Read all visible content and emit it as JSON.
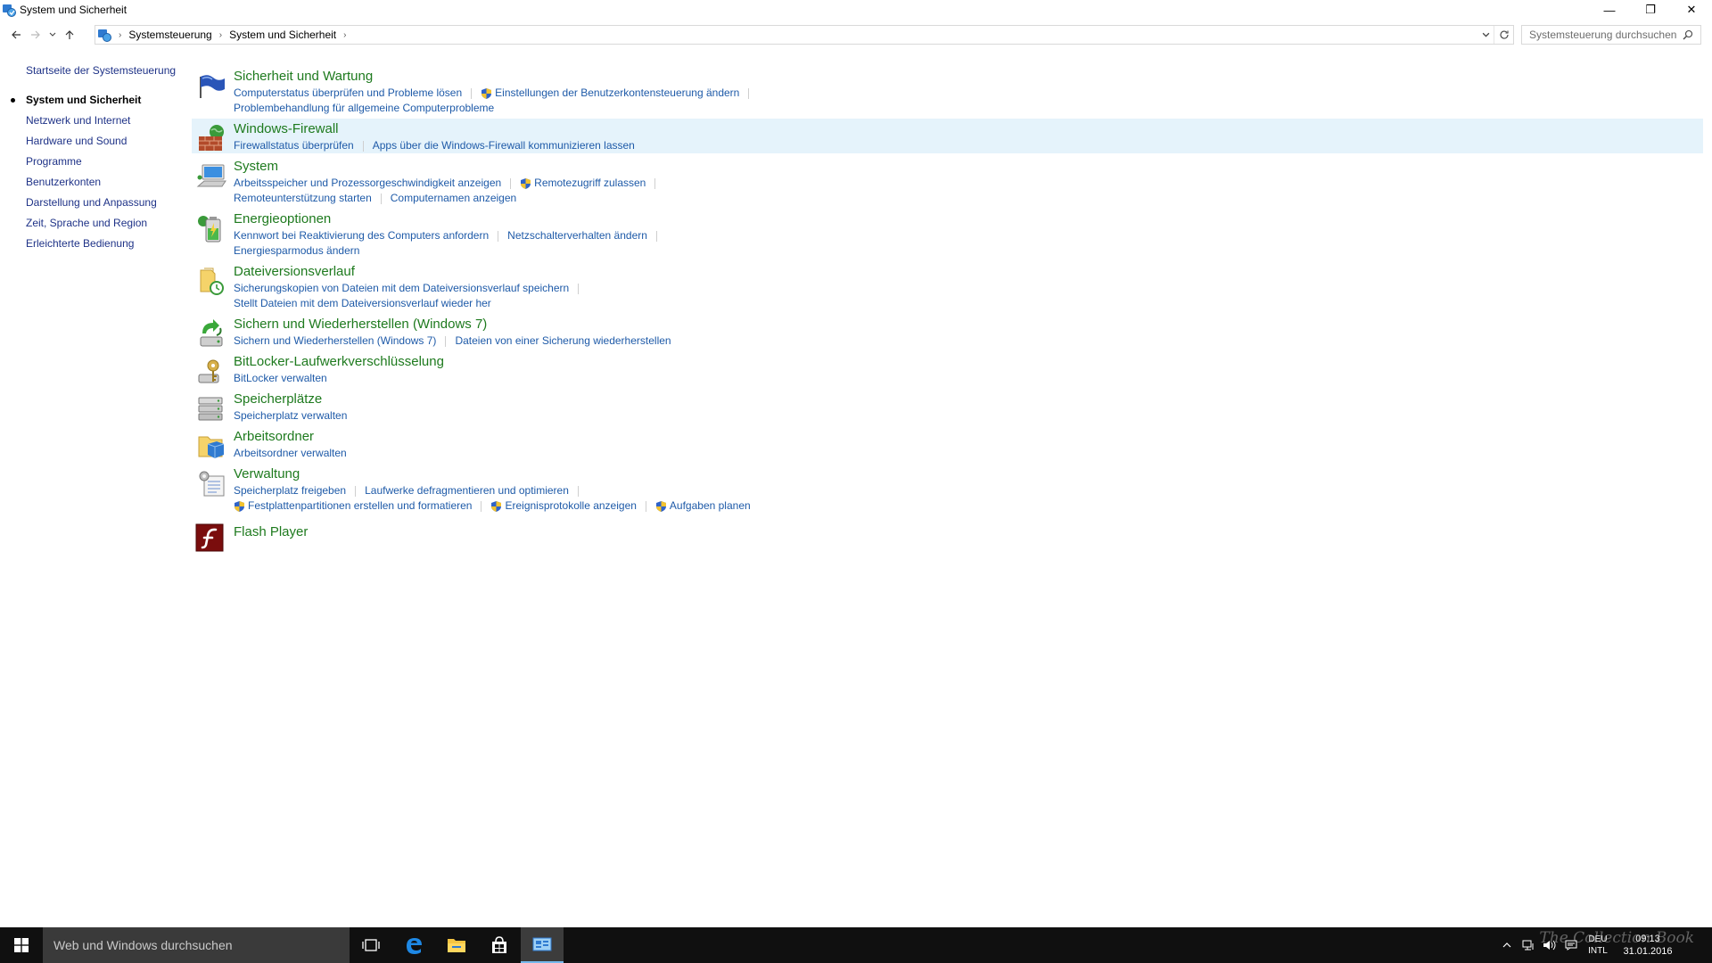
{
  "window": {
    "title": "System und Sicherheit",
    "minimize_glyph": "—",
    "restore_glyph": "❐",
    "close_glyph": "✕"
  },
  "address_bar": {
    "breadcrumbs": [
      "Systemsteuerung",
      "System und Sicherheit"
    ],
    "search_placeholder": "Systemsteuerung durchsuchen"
  },
  "sidebar": {
    "home": "Startseite der Systemsteuerung",
    "items": [
      {
        "label": "System und Sicherheit",
        "current": true
      },
      {
        "label": "Netzwerk und Internet"
      },
      {
        "label": "Hardware und Sound"
      },
      {
        "label": "Programme"
      },
      {
        "label": "Benutzerkonten"
      },
      {
        "label": "Darstellung und Anpassung"
      },
      {
        "label": "Zeit, Sprache und Region"
      },
      {
        "label": "Erleichterte Bedienung"
      }
    ]
  },
  "categories": [
    {
      "title": "Sicherheit und Wartung",
      "icon": "flag-icon",
      "rows": [
        [
          {
            "text": "Computerstatus überprüfen und Probleme lösen"
          },
          {
            "text": "Einstellungen der Benutzerkontensteuerung ändern",
            "shield": true
          }
        ],
        [
          {
            "text": "Problembehandlung für allgemeine Computerprobleme"
          }
        ]
      ]
    },
    {
      "title": "Windows-Firewall",
      "icon": "firewall-icon",
      "hover": true,
      "rows": [
        [
          {
            "text": "Firewallstatus überprüfen"
          },
          {
            "text": "Apps über die Windows-Firewall kommunizieren lassen"
          }
        ]
      ]
    },
    {
      "title": "System",
      "icon": "computer-icon",
      "rows": [
        [
          {
            "text": "Arbeitsspeicher und Prozessorgeschwindigkeit anzeigen"
          },
          {
            "text": "Remotezugriff zulassen",
            "shield": true
          }
        ],
        [
          {
            "text": "Remoteunterstützung starten"
          },
          {
            "text": "Computernamen anzeigen"
          }
        ]
      ]
    },
    {
      "title": "Energieoptionen",
      "icon": "battery-icon",
      "rows": [
        [
          {
            "text": "Kennwort bei Reaktivierung des Computers anfordern"
          },
          {
            "text": "Netzschalterverhalten ändern"
          }
        ],
        [
          {
            "text": "Energiesparmodus ändern"
          }
        ]
      ]
    },
    {
      "title": "Dateiversionsverlauf",
      "icon": "file-history-icon",
      "rows": [
        [
          {
            "text": "Sicherungskopien von Dateien mit dem Dateiversionsverlauf speichern"
          }
        ],
        [
          {
            "text": "Stellt Dateien mit dem Dateiversionsverlauf wieder her"
          }
        ]
      ]
    },
    {
      "title": "Sichern und Wiederherstellen (Windows 7)",
      "icon": "backup-icon",
      "rows": [
        [
          {
            "text": "Sichern und Wiederherstellen (Windows 7)"
          },
          {
            "text": "Dateien von einer Sicherung wiederherstellen"
          }
        ]
      ]
    },
    {
      "title": "BitLocker-Laufwerkverschlüsselung",
      "icon": "bitlocker-icon",
      "rows": [
        [
          {
            "text": "BitLocker verwalten"
          }
        ]
      ]
    },
    {
      "title": "Speicherplätze",
      "icon": "storage-spaces-icon",
      "rows": [
        [
          {
            "text": "Speicherplatz verwalten"
          }
        ]
      ]
    },
    {
      "title": "Arbeitsordner",
      "icon": "work-folders-icon",
      "rows": [
        [
          {
            "text": "Arbeitsordner verwalten"
          }
        ]
      ]
    },
    {
      "title": "Verwaltung",
      "icon": "admin-tools-icon",
      "rows": [
        [
          {
            "text": "Speicherplatz freigeben"
          },
          {
            "text": "Laufwerke defragmentieren und optimieren"
          }
        ],
        [
          {
            "text": "Festplattenpartitionen erstellen und formatieren",
            "shield": true
          },
          {
            "text": "Ereignisprotokolle anzeigen",
            "shield": true
          },
          {
            "text": "Aufgaben planen",
            "shield": true
          }
        ]
      ]
    },
    {
      "title": "Flash Player",
      "icon": "flash-player-icon",
      "rows": []
    }
  ],
  "taskbar": {
    "search_placeholder": "Web und Windows durchsuchen",
    "lang_top": "DEU",
    "lang_bottom": "INTL",
    "time": "09:13",
    "date": "31.01.2016",
    "watermark": "The Collection Book"
  }
}
